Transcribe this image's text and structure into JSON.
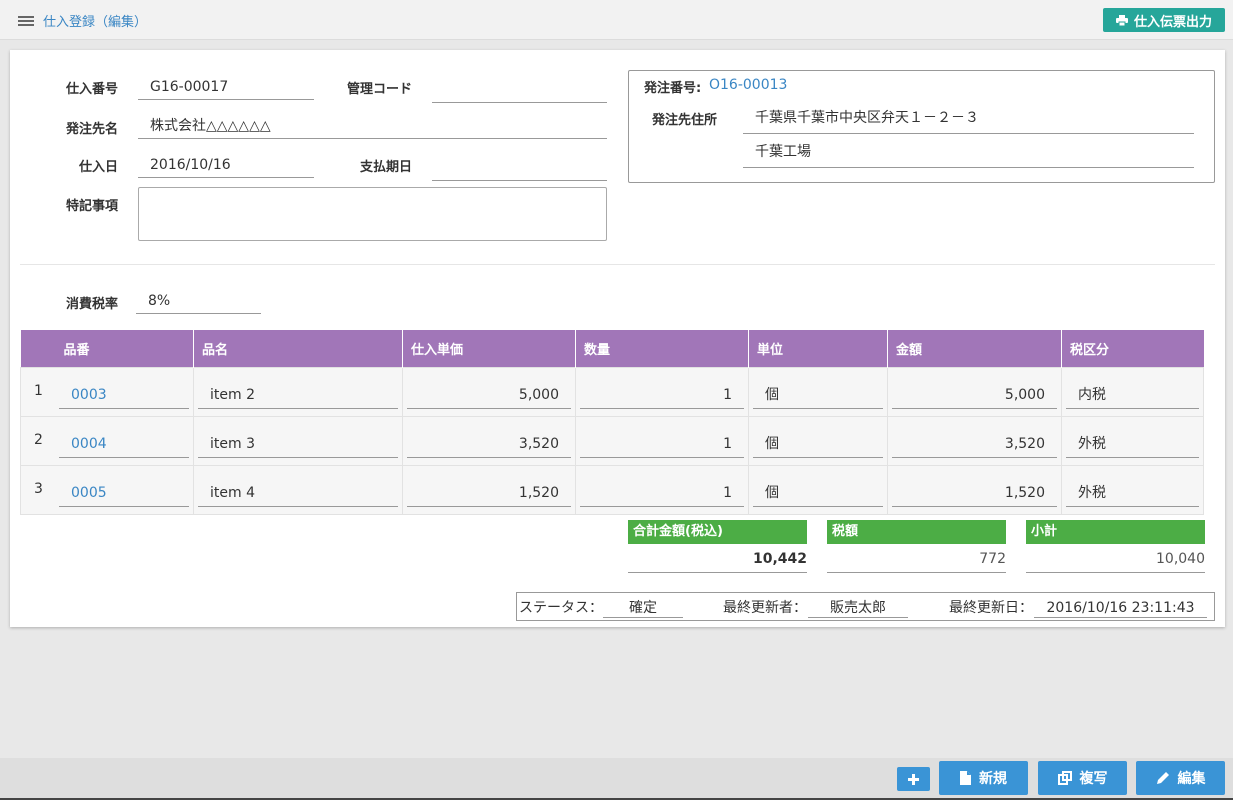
{
  "header": {
    "breadcrumb": "仕入登録（編集）",
    "print_button": "仕入伝票出力"
  },
  "form": {
    "purchase_no_label": "仕入番号",
    "purchase_no": "G16-00017",
    "mgmt_code_label": "管理コード",
    "mgmt_code": "",
    "supplier_label": "発注先名",
    "supplier": "株式会社△△△△△△",
    "purchase_date_label": "仕入日",
    "purchase_date": "2016/10/16",
    "payment_due_label": "支払期日",
    "payment_due": "",
    "notes_label": "特記事項",
    "notes": ""
  },
  "order": {
    "order_no_label": "発注番号:",
    "order_no": "O16-00013",
    "address_label": "発注先住所",
    "address1": "千葉県千葉市中央区弁天１－２－３",
    "address2": "千葉工場"
  },
  "tax": {
    "label": "消費税率",
    "rate": "8%"
  },
  "table": {
    "columns": [
      "品番",
      "品名",
      "仕入単価",
      "数量",
      "単位",
      "金額",
      "税区分"
    ],
    "rows": [
      {
        "no": "1",
        "code": "0003",
        "name": "item 2",
        "price": "5,000",
        "qty": "1",
        "unit": "個",
        "amount": "5,000",
        "tax": "内税"
      },
      {
        "no": "2",
        "code": "0004",
        "name": "item 3",
        "price": "3,520",
        "qty": "1",
        "unit": "個",
        "amount": "3,520",
        "tax": "外税"
      },
      {
        "no": "3",
        "code": "0005",
        "name": "item 4",
        "price": "1,520",
        "qty": "1",
        "unit": "個",
        "amount": "1,520",
        "tax": "外税"
      }
    ]
  },
  "totals": {
    "total_label": "合計金額(税込)",
    "total": "10,442",
    "tax_label": "税額",
    "tax": "772",
    "subtotal_label": "小計",
    "subtotal": "10,040"
  },
  "status": {
    "status_label": "ステータス：",
    "status": "確定",
    "updater_label": "最終更新者：",
    "updater": "販売太郎",
    "updated_label": "最終更新日：",
    "updated": "2016/10/16 23:11:43"
  },
  "footer": {
    "add_icon": "plus-icon",
    "new_label": "新規",
    "copy_label": "複写",
    "edit_label": "編集"
  },
  "colors": {
    "accent": "#3a86c4",
    "table_header": "#a176b8",
    "totals_header": "#4cad45",
    "print_button": "#26a69a"
  }
}
